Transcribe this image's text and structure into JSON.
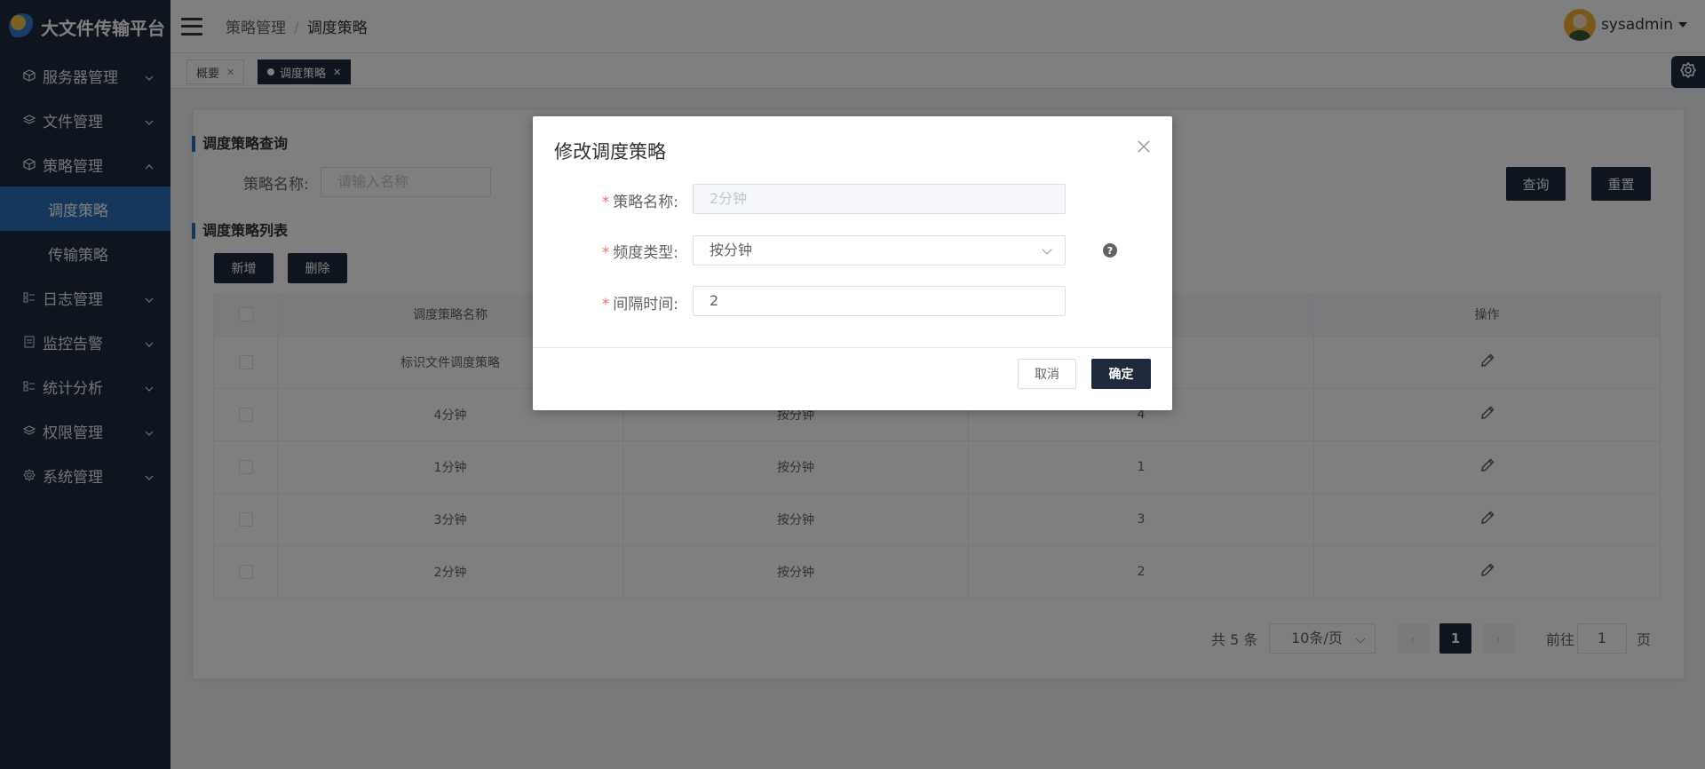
{
  "app": {
    "title": "大文件传输平台"
  },
  "sidebar": {
    "items": [
      {
        "label": "服务器管理",
        "icon": "cube-icon"
      },
      {
        "label": "文件管理",
        "icon": "layers-icon"
      },
      {
        "label": "策略管理",
        "icon": "cube-icon",
        "expanded": true,
        "children": [
          {
            "label": "调度策略",
            "active": true
          },
          {
            "label": "传输策略"
          }
        ]
      },
      {
        "label": "日志管理",
        "icon": "list-icon"
      },
      {
        "label": "监控告警",
        "icon": "monitor-icon"
      },
      {
        "label": "统计分析",
        "icon": "list-icon"
      },
      {
        "label": "权限管理",
        "icon": "layers-icon"
      },
      {
        "label": "系统管理",
        "icon": "gear-icon"
      }
    ]
  },
  "header": {
    "breadcrumb": [
      "策略管理",
      "调度策略"
    ],
    "user": "sysadmin"
  },
  "tags": [
    {
      "label": "概要",
      "active": false
    },
    {
      "label": "调度策略",
      "active": true
    }
  ],
  "query": {
    "title": "调度策略查询",
    "name_label": "策略名称:",
    "name_placeholder": "请输入名称",
    "search_btn": "查询",
    "reset_btn": "重置"
  },
  "list": {
    "title": "调度策略列表",
    "add_btn": "新增",
    "delete_btn": "删除",
    "columns": [
      "调度策略名称",
      "",
      "",
      "操作"
    ],
    "rows": [
      {
        "name": "标识文件调度策略",
        "type": "",
        "interval": ""
      },
      {
        "name": "4分钟",
        "type": "按分钟",
        "interval": "4"
      },
      {
        "name": "1分钟",
        "type": "按分钟",
        "interval": "1"
      },
      {
        "name": "3分钟",
        "type": "按分钟",
        "interval": "3"
      },
      {
        "name": "2分钟",
        "type": "按分钟",
        "interval": "2"
      }
    ]
  },
  "pagination": {
    "total": "共 5 条",
    "page_size": "10条/页",
    "current": "1",
    "goto_label": "前往",
    "goto_value": "1",
    "page_label": "页"
  },
  "dialog": {
    "title": "修改调度策略",
    "fields": {
      "name_label": "策略名称:",
      "name_value": "2分钟",
      "type_label": "频度类型:",
      "type_value": "按分钟",
      "interval_label": "间隔时间:",
      "interval_value": "2"
    },
    "required_mark": "*",
    "help": "?",
    "cancel": "取消",
    "confirm": "确定"
  },
  "colors": {
    "sidebar": "#1e2a3c",
    "accent": "#2a6fb6",
    "required": "#f56c6c"
  }
}
